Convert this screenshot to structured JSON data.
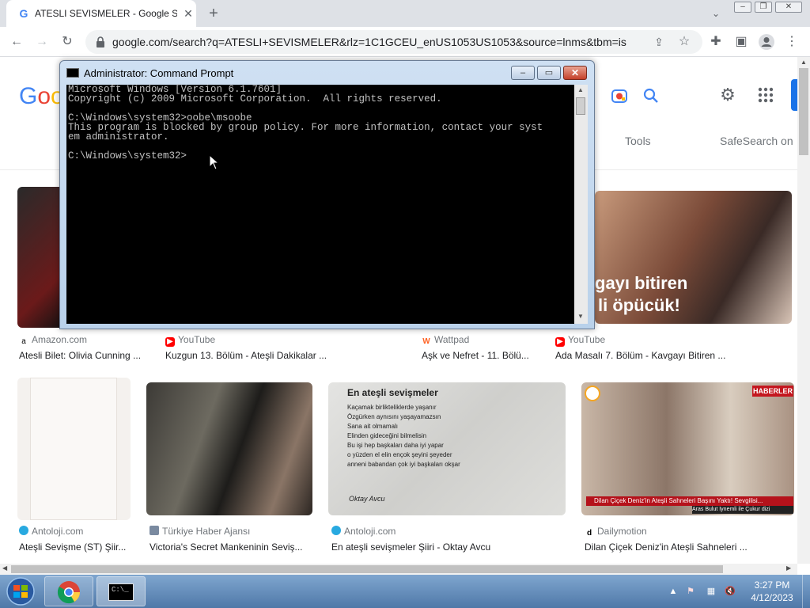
{
  "browser": {
    "tab_title": "ATESLI SEVISMELER - Google Search",
    "new_tab_symbol": "+",
    "url": "google.com/search?q=ATESLI+SEVISMELER&rlz=1C1GCEU_enUS1053US1053&source=lnms&tbm=isch&sa..."
  },
  "google": {
    "logo_text": "Goo",
    "tools_label": "Tools",
    "safesearch_label": "SafeSearch on"
  },
  "results": [
    {
      "source": "Amazon.com",
      "caption": "Atesli Bilet: Olivia Cunning ...",
      "source_icon": "amazon-icon"
    },
    {
      "source": "YouTube",
      "caption": "Kuzgun 13. Bölüm - Ateşli Dakikalar ...",
      "source_icon": "youtube-icon"
    },
    {
      "source": "Wattpad",
      "caption": "Aşk ve Nefret - 11. Bölü...",
      "source_icon": "wattpad-icon"
    },
    {
      "source": "YouTube",
      "caption": "Ada Masalı 7. Bölüm - Kavgayı Bitiren ...",
      "source_icon": "youtube-icon"
    },
    {
      "source": "Antoloji.com",
      "caption": "Ateşli Sevişme (ST) Şiir...",
      "source_icon": "antoloji-icon"
    },
    {
      "source": "Türkiye Haber Ajansı",
      "caption": "Victoria's Secret Mankeninin Seviş...",
      "source_icon": "news-icon"
    },
    {
      "source": "Antoloji.com",
      "caption": "En ateşli sevişmeler Şiiri - Oktay Avcu",
      "source_icon": "antoloji-icon"
    },
    {
      "source": "Dailymotion",
      "caption": "Dilan Çiçek Deniz'in Ateşli Sahneleri ...",
      "source_icon": "dailymotion-icon"
    }
  ],
  "thumb_text": {
    "kiss_overlay_1": "gayı bitiren",
    "kiss_overlay_2": "li öpücük!",
    "poem_title": "En ateşli sevişmeler",
    "poem_lines": [
      "Kaçamak birlikteliklerde yaşanır",
      "Özgürken aynısını yaşayamazsın",
      "Sana ait olmamalı",
      "Elinden gideceğini bilmelisin",
      "Bu işi hep başkaları daha iyi yapar",
      "o yüzden el elin ençok şeyini şeyeder",
      "anneni babandan çok iyi başkaları okşar"
    ],
    "poem_author": "Oktay Avcu",
    "haberler_badge": "HABERLER",
    "dilan_overlay": "Dilan Çiçek Deniz'in Ateşli Sahneleri Başını Yaktı! Sevgilisi...",
    "dilan_sub": "Aras Bulut İynemli ile Çukur dizi"
  },
  "cmd": {
    "title": "Administrator: Command Prompt",
    "lines": [
      "Microsoft Windows [Version 6.1.7601]",
      "Copyright (c) 2009 Microsoft Corporation.  All rights reserved.",
      "",
      "C:\\Windows\\system32>oobe\\msoobe",
      "This program is blocked by group policy. For more information, contact your syst",
      "em administrator.",
      "",
      "C:\\Windows\\system32>"
    ]
  },
  "taskbar": {
    "time": "3:27 PM",
    "date": "4/12/2023"
  }
}
